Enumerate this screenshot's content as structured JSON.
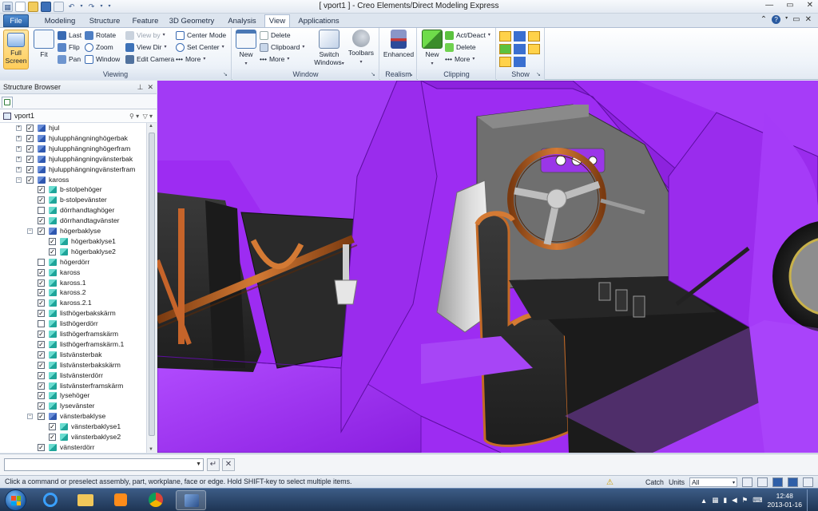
{
  "window": {
    "title": "[ vport1 ] - Creo Elements/Direct Modeling Express"
  },
  "tabs": [
    {
      "label": "File"
    },
    {
      "label": "Modeling"
    },
    {
      "label": "Structure"
    },
    {
      "label": "Feature"
    },
    {
      "label": "3D Geometry"
    },
    {
      "label": "Analysis"
    },
    {
      "label": "View"
    },
    {
      "label": "Applications"
    }
  ],
  "ribbon": {
    "viewing": {
      "label": "Viewing",
      "full_screen": "Full Screen",
      "fit": "Fit",
      "last": "Last",
      "flip": "Flip",
      "pan": "Pan",
      "rotate": "Rotate",
      "zoom": "Zoom",
      "window": "Window",
      "view_by": "View by",
      "view_dir": "View Dir",
      "edit_camera": "Edit Camera",
      "center_mode": "Center Mode",
      "set_center": "Set Center",
      "more": "More"
    },
    "window": {
      "label": "Window",
      "new": "New",
      "delete": "Delete",
      "clipboard": "Clipboard",
      "more": "More",
      "switch_windows": "Switch Windows",
      "toolbars": "Toolbars"
    },
    "realism": {
      "label": "Realism",
      "enhanced": "Enhanced"
    },
    "clipping": {
      "label": "Clipping",
      "new": "New",
      "act_deact": "Act/Deact",
      "delete": "Delete",
      "more": "More"
    },
    "show": {
      "label": "Show"
    }
  },
  "structure_browser": {
    "title": "Structure Browser",
    "root": "vport1",
    "items": [
      {
        "label": "hjul",
        "level": 1,
        "type": "asm",
        "checked": true,
        "expander": "+"
      },
      {
        "label": "hjulupphängninghögerbak",
        "level": 1,
        "type": "asm",
        "checked": true,
        "expander": "+"
      },
      {
        "label": "hjulupphängninghögerfram",
        "level": 1,
        "type": "asm",
        "checked": true,
        "expander": "+"
      },
      {
        "label": "hjulupphängningvänsterbak",
        "level": 1,
        "type": "asm",
        "checked": true,
        "expander": "+"
      },
      {
        "label": "hjulupphängningvänsterfram",
        "level": 1,
        "type": "asm",
        "checked": true,
        "expander": "+"
      },
      {
        "label": "kaross",
        "level": 1,
        "type": "asm",
        "checked": true,
        "expander": "−"
      },
      {
        "label": "b-stolpehöger",
        "level": 2,
        "type": "part",
        "checked": true,
        "expander": ""
      },
      {
        "label": "b-stolpevänster",
        "level": 2,
        "type": "part",
        "checked": true,
        "expander": ""
      },
      {
        "label": "dörrhandtaghöger",
        "level": 2,
        "type": "part",
        "checked": false,
        "expander": ""
      },
      {
        "label": "dörrhandtagvänster",
        "level": 2,
        "type": "part",
        "checked": true,
        "expander": ""
      },
      {
        "label": "högerbaklyse",
        "level": 2,
        "type": "asm",
        "checked": true,
        "expander": "−"
      },
      {
        "label": "högerbaklyse1",
        "level": 3,
        "type": "part",
        "checked": true,
        "expander": ""
      },
      {
        "label": "högerbaklyse2",
        "level": 3,
        "type": "part",
        "checked": true,
        "expander": ""
      },
      {
        "label": "högerdörr",
        "level": 2,
        "type": "part",
        "checked": false,
        "expander": ""
      },
      {
        "label": "kaross",
        "level": 2,
        "type": "part",
        "checked": true,
        "expander": ""
      },
      {
        "label": "kaross.1",
        "level": 2,
        "type": "part",
        "checked": true,
        "expander": ""
      },
      {
        "label": "kaross.2",
        "level": 2,
        "type": "part",
        "checked": true,
        "expander": ""
      },
      {
        "label": "kaross.2.1",
        "level": 2,
        "type": "part",
        "checked": true,
        "expander": ""
      },
      {
        "label": "listhögerbakskärm",
        "level": 2,
        "type": "part",
        "checked": true,
        "expander": ""
      },
      {
        "label": "listhögerdörr",
        "level": 2,
        "type": "part",
        "checked": false,
        "expander": ""
      },
      {
        "label": "listhögerframskärm",
        "level": 2,
        "type": "part",
        "checked": true,
        "expander": ""
      },
      {
        "label": "listhögerframskärm.1",
        "level": 2,
        "type": "part",
        "checked": true,
        "expander": ""
      },
      {
        "label": "listvänsterbak",
        "level": 2,
        "type": "part",
        "checked": true,
        "expander": ""
      },
      {
        "label": "listvänsterbakskärm",
        "level": 2,
        "type": "part",
        "checked": true,
        "expander": ""
      },
      {
        "label": "listvänsterdörr",
        "level": 2,
        "type": "part",
        "checked": true,
        "expander": ""
      },
      {
        "label": "listvänsterframskärm",
        "level": 2,
        "type": "part",
        "checked": true,
        "expander": ""
      },
      {
        "label": "lysehöger",
        "level": 2,
        "type": "part",
        "checked": true,
        "expander": ""
      },
      {
        "label": "lysevänster",
        "level": 2,
        "type": "part",
        "checked": true,
        "expander": ""
      },
      {
        "label": "vänsterbaklyse",
        "level": 2,
        "type": "asm",
        "checked": true,
        "expander": "−"
      },
      {
        "label": "vänsterbaklyse1",
        "level": 3,
        "type": "part",
        "checked": true,
        "expander": ""
      },
      {
        "label": "vänsterbaklyse2",
        "level": 3,
        "type": "part",
        "checked": true,
        "expander": ""
      },
      {
        "label": "vänsterdörr",
        "level": 2,
        "type": "part",
        "checked": true,
        "expander": ""
      }
    ]
  },
  "status": {
    "message": "Click a command or preselect assembly, part, workplane, face or edge. Hold SHIFT-key to select multiple items.",
    "catch": "Catch",
    "units": "Units",
    "units_value": "All"
  },
  "taskbar": {
    "time": "12:48",
    "date": "2013-01-16"
  }
}
